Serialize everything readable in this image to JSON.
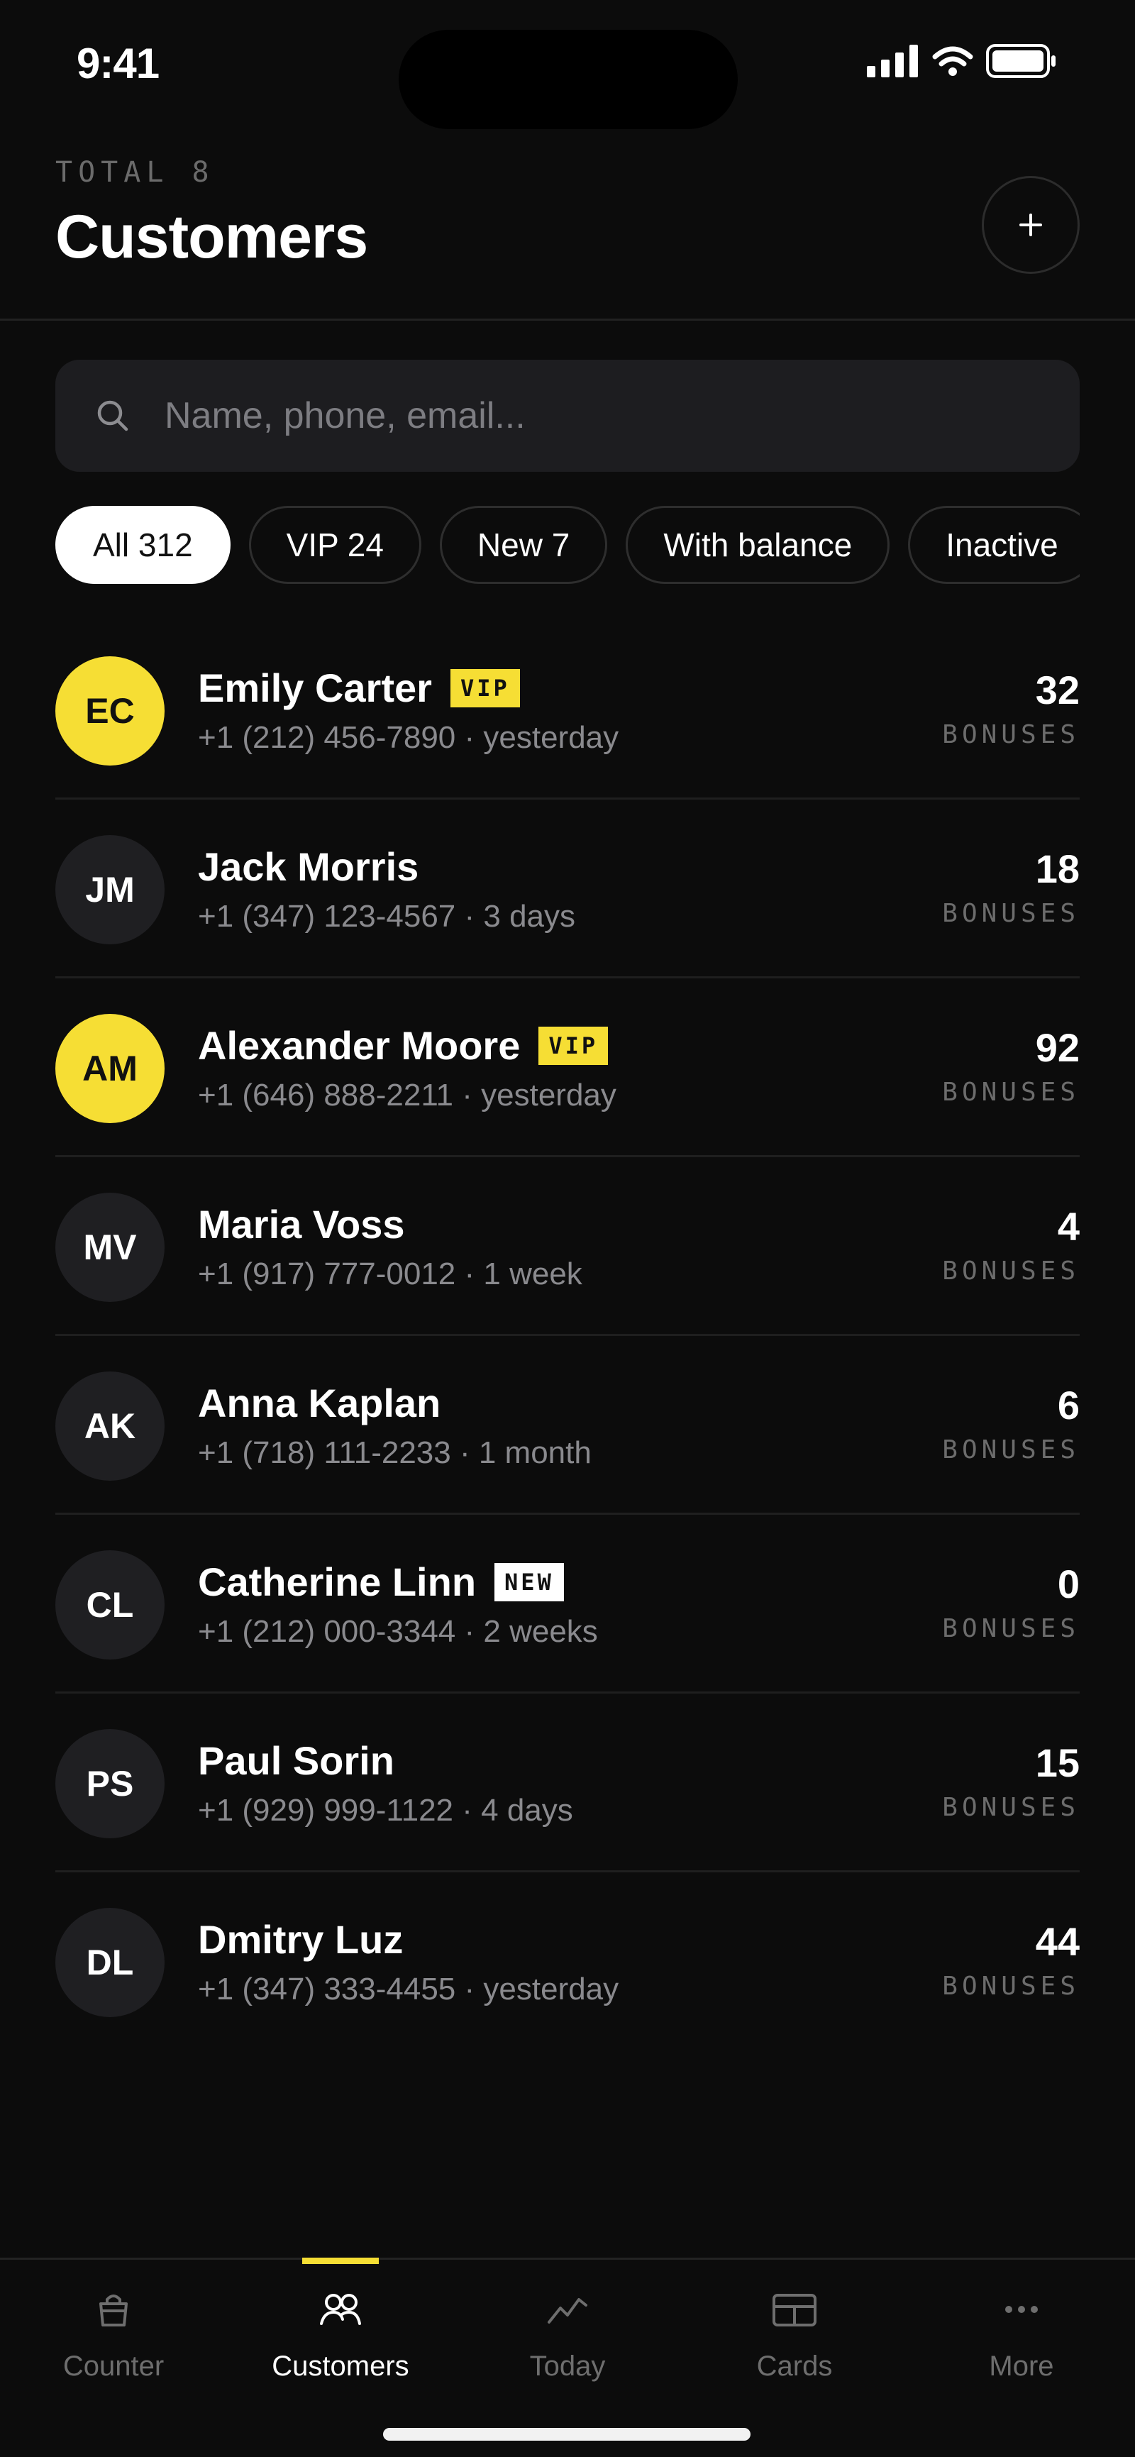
{
  "status_bar": {
    "time": "9:41"
  },
  "header": {
    "eyebrow": "TOTAL 8",
    "title": "Customers",
    "add_label": "+"
  },
  "search": {
    "placeholder": "Name, phone, email..."
  },
  "filters": [
    {
      "label": "All 312",
      "active": true
    },
    {
      "label": "VIP 24",
      "active": false
    },
    {
      "label": "New 7",
      "active": false
    },
    {
      "label": "With balance",
      "active": false
    },
    {
      "label": "Inactive",
      "active": false
    }
  ],
  "customers": [
    {
      "initials": "EC",
      "name": "Emily Carter",
      "badge": "VIP",
      "phone": "+1 (212) 456-7890",
      "last_visit": "yesterday",
      "bonuses": "32"
    },
    {
      "initials": "JM",
      "name": "Jack Morris",
      "badge": "",
      "phone": "+1 (347) 123-4567",
      "last_visit": "3 days",
      "bonuses": "18"
    },
    {
      "initials": "AM",
      "name": "Alexander Moore",
      "badge": "VIP",
      "phone": "+1 (646) 888-2211",
      "last_visit": "yesterday",
      "bonuses": "92"
    },
    {
      "initials": "MV",
      "name": "Maria Voss",
      "badge": "",
      "phone": "+1 (917) 777-0012",
      "last_visit": "1 week",
      "bonuses": "4"
    },
    {
      "initials": "AK",
      "name": "Anna Kaplan",
      "badge": "",
      "phone": "+1 (718) 111-2233",
      "last_visit": "1 month",
      "bonuses": "6"
    },
    {
      "initials": "CL",
      "name": "Catherine Linn",
      "badge": "NEW",
      "phone": "+1 (212) 000-3344",
      "last_visit": "2 weeks",
      "bonuses": "0"
    },
    {
      "initials": "PS",
      "name": "Paul Sorin",
      "badge": "",
      "phone": "+1 (929) 999-1122",
      "last_visit": "4 days",
      "bonuses": "15"
    },
    {
      "initials": "DL",
      "name": "Dmitry Luz",
      "badge": "",
      "phone": "+1 (347) 333-4455",
      "last_visit": "yesterday",
      "bonuses": "44"
    }
  ],
  "bonus_label": "BONUSES",
  "meta_separator": " · ",
  "tabs": [
    {
      "label": "Counter",
      "icon": "bag-icon",
      "active": false
    },
    {
      "label": "Customers",
      "icon": "people-icon",
      "active": true
    },
    {
      "label": "Today",
      "icon": "trend-icon",
      "active": false
    },
    {
      "label": "Cards",
      "icon": "card-icon",
      "active": false
    },
    {
      "label": "More",
      "icon": "more-icon",
      "active": false
    }
  ],
  "colors": {
    "accent": "#f6de34",
    "background": "#0c0c0c",
    "surface": "#1d1d20",
    "muted": "#8a8a8e"
  }
}
